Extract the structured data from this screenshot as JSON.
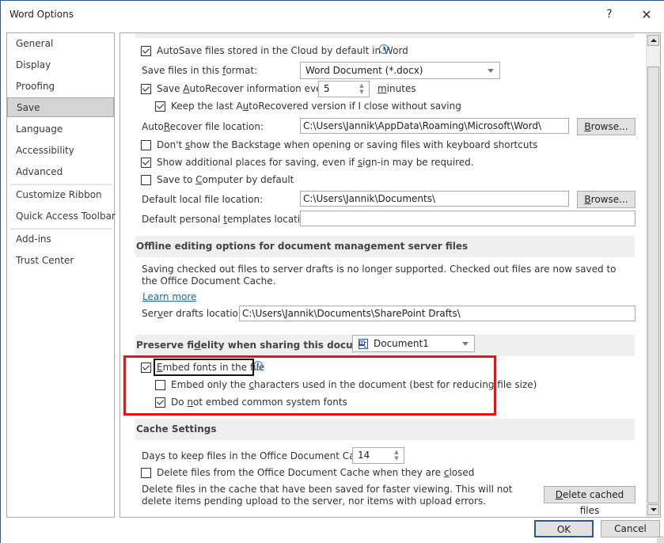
{
  "window": {
    "title": "Word Options",
    "help_label": "?",
    "close_label": "✕"
  },
  "sidebar": {
    "items": [
      {
        "label": "General",
        "selected": false
      },
      {
        "label": "Display",
        "selected": false
      },
      {
        "label": "Proofing",
        "selected": false
      },
      {
        "label": "Save",
        "selected": true
      },
      {
        "label": "Language",
        "selected": false
      },
      {
        "label": "Accessibility",
        "selected": false
      },
      {
        "label": "Advanced",
        "selected": false
      },
      {
        "label": "Customize Ribbon",
        "selected": false
      },
      {
        "label": "Quick Access Toolbar",
        "selected": false
      },
      {
        "label": "Add-ins",
        "selected": false
      },
      {
        "label": "Trust Center",
        "selected": false
      }
    ]
  },
  "save": {
    "autosave": {
      "label": "AutoSave files stored in the Cloud by default in Word",
      "checked": true
    },
    "format": {
      "label_pre": "Save files in this ",
      "label_u": "f",
      "label_post": "ormat:",
      "value": "Word Document (*.docx)"
    },
    "autorecover": {
      "label_pre": "Save ",
      "label_u": "A",
      "label_post": "utoRecover information every",
      "checked": true,
      "minutes": "5",
      "minutes_label_u": "m",
      "minutes_label_post": "inutes"
    },
    "keep_last": {
      "label_pre": "Keep the last A",
      "label_u": "u",
      "label_post": "toRecovered version if I close without saving",
      "checked": true
    },
    "autorecover_location": {
      "label_pre": "Auto",
      "label_u": "R",
      "label_post": "ecover file location:",
      "value": "C:\\Users\\Jannik\\AppData\\Roaming\\Microsoft\\Word\\",
      "browse_u": "B",
      "browse_post": "rowse..."
    },
    "dont_show_backstage": {
      "label_pre": "Don't ",
      "label_u": "s",
      "label_post": "how the Backstage when opening or saving files with keyboard shortcuts",
      "checked": false
    },
    "show_additional": {
      "label_pre": "Show additional places for saving, even if ",
      "label_u": "s",
      "label_post": "ign-in may be required.",
      "checked": true
    },
    "save_to_computer": {
      "label_pre": "Save to ",
      "label_u": "C",
      "label_post": "omputer by default",
      "checked": false
    },
    "default_local": {
      "label_pre": "Default local f",
      "label_u": "i",
      "label_post": "le location:",
      "value": "C:\\Users\\Jannik\\Documents\\",
      "browse_u": "B",
      "browse_post": "rowse..."
    },
    "default_templates": {
      "label_pre": "Default personal ",
      "label_u": "t",
      "label_post": "emplates location:",
      "value": ""
    }
  },
  "offline": {
    "header": "Offline editing options for document management server files",
    "description": "Saving checked out files to server drafts is no longer supported. Checked out files are now saved to the Office Document Cache.",
    "learn_more": "Learn more",
    "server_drafts": {
      "label_pre": "Ser",
      "label_u": "v",
      "label_post": "er drafts location:",
      "value": "C:\\Users\\Jannik\\Documents\\SharePoint Drafts\\"
    }
  },
  "fidelity": {
    "header_pre": "Preserve fi",
    "header_u": "d",
    "header_post": "elity when sharing this document:",
    "document": "Document1",
    "embed_fonts": {
      "label_u": "E",
      "label_post": "mbed fonts in the file",
      "checked": true
    },
    "embed_only_used": {
      "label_pre": "Embed only the ",
      "label_u": "c",
      "label_post": "haracters used in the document (best for reducing file size)",
      "checked": false
    },
    "no_common_fonts": {
      "label_pre": "Do ",
      "label_u": "n",
      "label_post": "ot embed common system fonts",
      "checked": true
    }
  },
  "cache": {
    "header": "Cache Settings",
    "days_label": "Days to keep files in the Office Document Cache:",
    "days_value": "14",
    "delete_on_close": {
      "label_pre": "Delete files from the Office Document Cache when they are ",
      "label_u": "c",
      "label_post": "losed",
      "checked": false
    },
    "description": "Delete files in the cache that have been saved for faster viewing. This will not delete items pending upload to the server, nor items with upload errors.",
    "delete_button_u": "D",
    "delete_button_post": "elete cached files"
  },
  "footer": {
    "ok": "OK",
    "cancel": "Cancel"
  },
  "colors": {
    "accent": "#2b579a",
    "highlight_red": "#ee1111",
    "info_blue": "#2f7fc7",
    "link": "#2361a8"
  }
}
